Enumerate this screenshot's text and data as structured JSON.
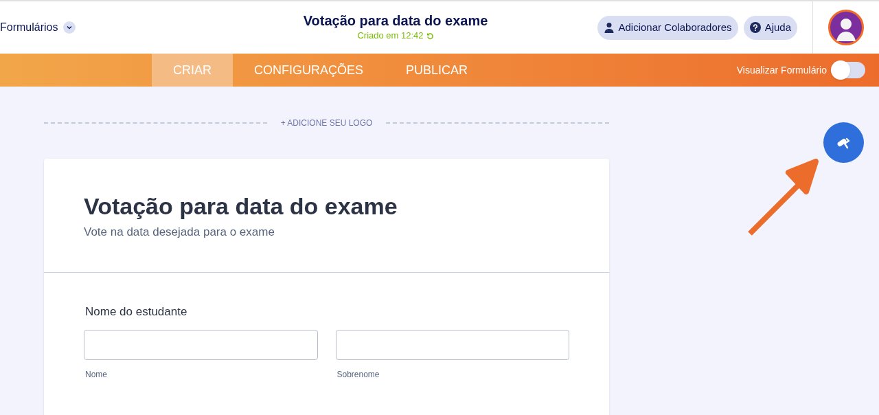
{
  "header": {
    "forms_menu": "Formulários",
    "title": "Votação para data do exame",
    "saved_status": "Criado em 12:42",
    "buttons": [
      {
        "kind": "collaborators",
        "label": "Adicionar Colaboradores"
      },
      {
        "kind": "help",
        "label": "Ajuda"
      }
    ]
  },
  "tabs": [
    {
      "label": "CRIAR",
      "selected": true
    },
    {
      "label": "CONFIGURAÇÕES",
      "selected": false
    },
    {
      "label": "PUBLICAR",
      "selected": false
    }
  ],
  "preview_toggle": {
    "label": "Visualizar Formulário",
    "on": false
  },
  "logo_link": "+ ADICIONE SEU LOGO",
  "form": {
    "title": "Votação para data do exame",
    "subtitle": "Vote na data desejada para o exame",
    "fields": [
      {
        "label": "Nome do estudante",
        "inputs": [
          {
            "sublabel": "Nome"
          },
          {
            "sublabel": "Sobrenome"
          }
        ]
      }
    ]
  }
}
